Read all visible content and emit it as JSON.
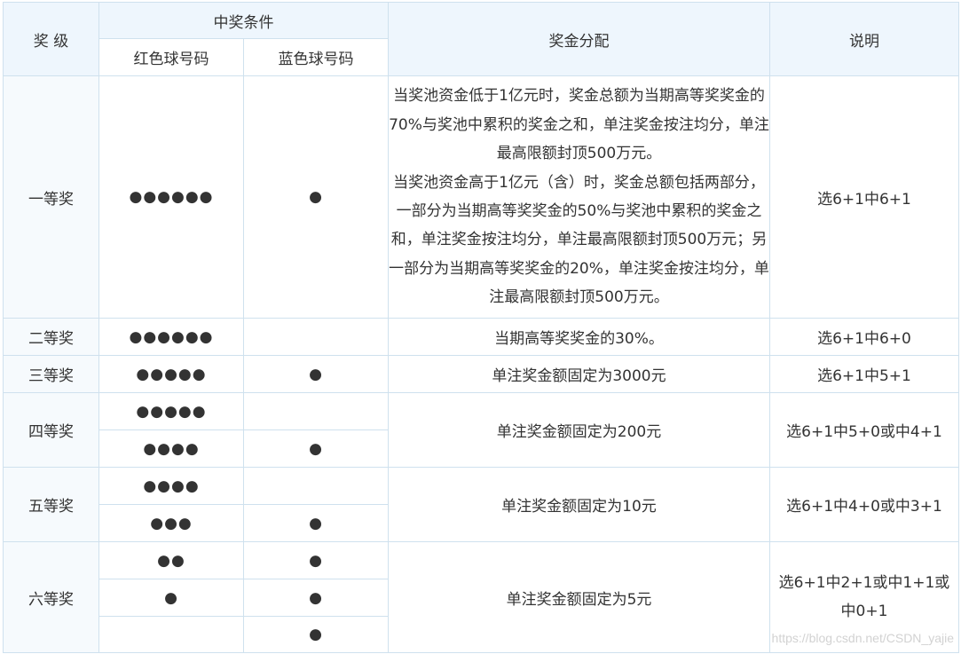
{
  "headers": {
    "level": "奖 级",
    "condition": "中奖条件",
    "red": "红色球号码",
    "blue": "蓝色球号码",
    "distribution": "奖金分配",
    "note": "说明"
  },
  "rows": {
    "first": {
      "level": "一等奖",
      "red": "●●●●●●",
      "blue": "●",
      "distribution_p1": "当奖池资金低于1亿元时，奖金总额为当期高等奖奖金的70%与奖池中累积的奖金之和，单注奖金按注均分，单注最高限额封顶500万元。",
      "distribution_p2": "当奖池资金高于1亿元（含）时，奖金总额包括两部分，一部分为当期高等奖奖金的50%与奖池中累积的奖金之和，单注奖金按注均分，单注最高限额封顶500万元；另一部分为当期高等奖奖金的20%，单注奖金按注均分，单注最高限额封顶500万元。",
      "note": "选6+1中6+1"
    },
    "second": {
      "level": "二等奖",
      "red": "●●●●●●",
      "blue": "",
      "distribution": "当期高等奖奖金的30%。",
      "note": "选6+1中6+0"
    },
    "third": {
      "level": "三等奖",
      "red": "●●●●●",
      "blue": "●",
      "distribution": "单注奖金额固定为3000元",
      "note": "选6+1中5+1"
    },
    "fourth": {
      "level": "四等奖",
      "red_a": "●●●●●",
      "blue_a": "",
      "red_b": "●●●●",
      "blue_b": "●",
      "distribution": "单注奖金额固定为200元",
      "note": "选6+1中5+0或中4+1"
    },
    "fifth": {
      "level": "五等奖",
      "red_a": "●●●●",
      "blue_a": "",
      "red_b": "●●●",
      "blue_b": "●",
      "distribution": "单注奖金额固定为10元",
      "note": "选6+1中4+0或中3+1"
    },
    "sixth": {
      "level": "六等奖",
      "red_a": "●●",
      "blue_a": "●",
      "red_b": "●",
      "blue_b": "●",
      "red_c": "",
      "blue_c": "●",
      "distribution": "单注奖金额固定为5元",
      "note": "选6+1中2+1或中1+1或中0+1"
    }
  },
  "watermark": "https://blog.csdn.net/CSDN_yajie"
}
